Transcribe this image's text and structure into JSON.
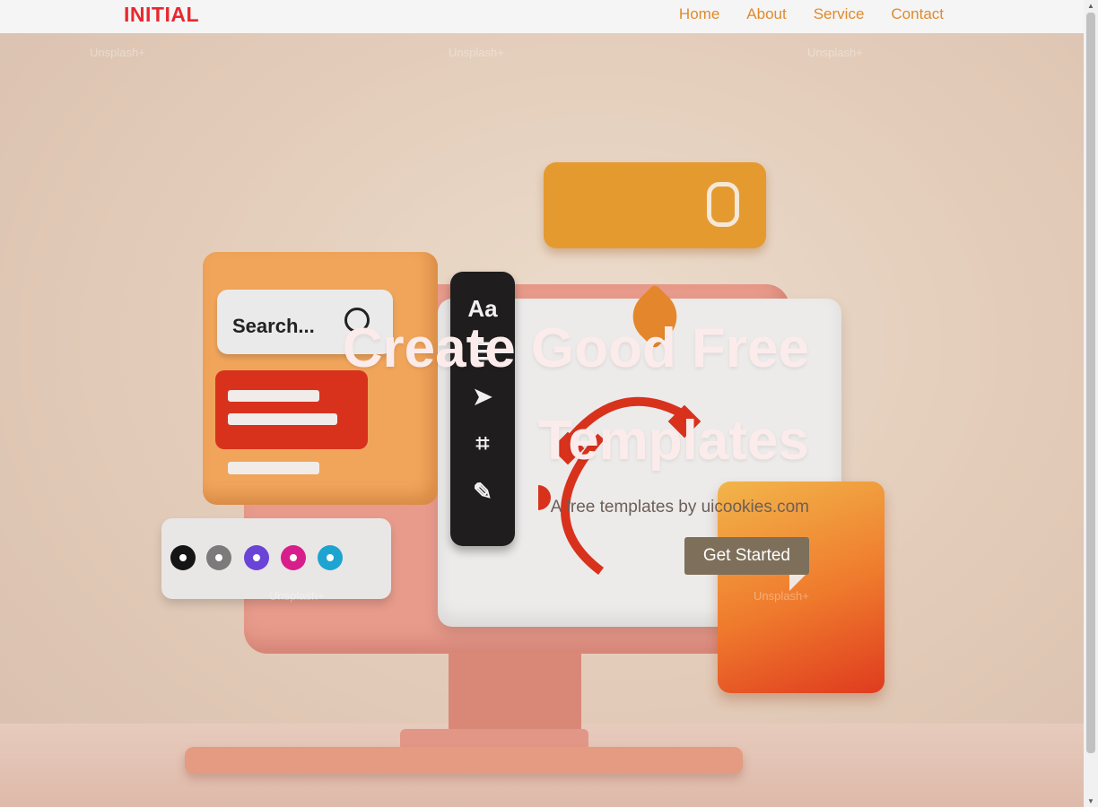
{
  "brand": "INITIAL",
  "nav": [
    "Home",
    "About",
    "Service",
    "Contact"
  ],
  "hero": {
    "title": "Create Good Free Templates",
    "subtitle": "A free templates by uicookies.com",
    "cta": "Get Started"
  },
  "illustration": {
    "search_text": "Search...",
    "font_tool": "Aa",
    "watermark": "Unsplash+"
  },
  "colors": {
    "brand": "#e8282e",
    "nav_link": "#e08a2c",
    "cta_bg": "#7d6f5a",
    "hero_title": "#fbeceb"
  },
  "icons": [
    "search-icon",
    "paperclip-icon",
    "font-icon",
    "sliders-icon",
    "cursor-icon",
    "crop-icon",
    "pen-icon",
    "pen-tool-icon"
  ]
}
